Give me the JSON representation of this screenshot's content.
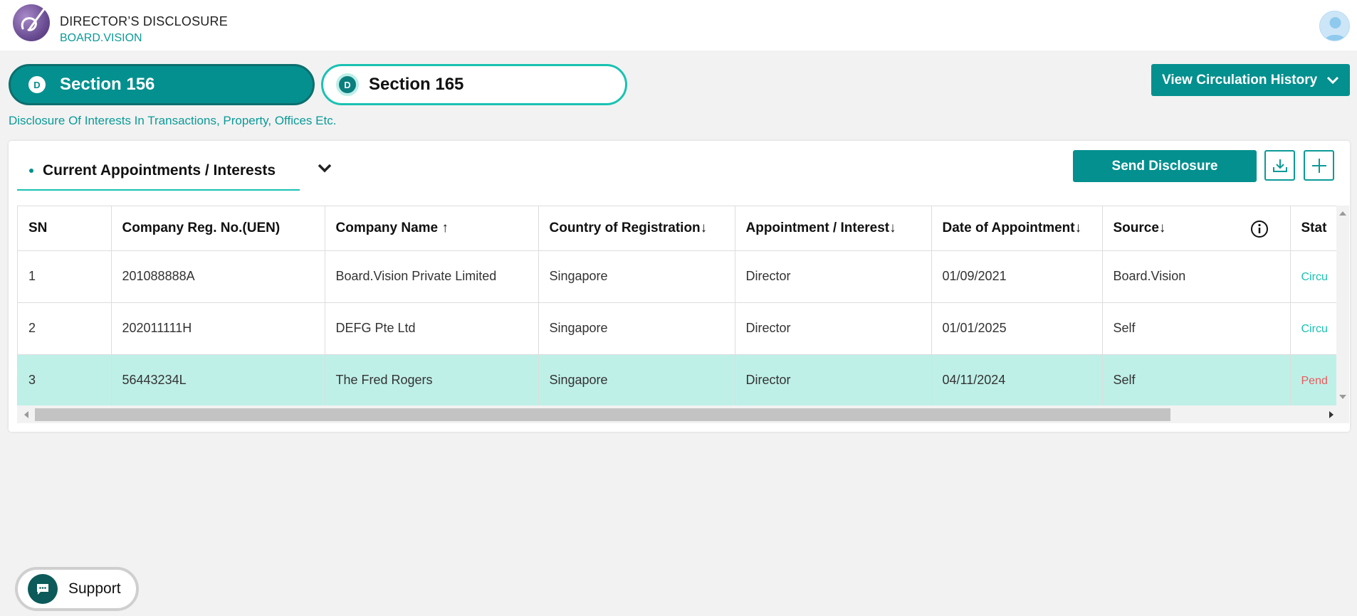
{
  "header": {
    "title": "DIRECTOR’S DISCLOSURE",
    "subtitle": "BOARD.VISION"
  },
  "section_tabs": [
    {
      "badge": "D",
      "label": "Section 156",
      "active": true
    },
    {
      "badge": "D",
      "label": "Section 165",
      "active": false
    }
  ],
  "history_button": "View Circulation History",
  "page_subtitle": "Disclosure Of Interests In Transactions, Property, Offices Etc.",
  "panel": {
    "tab_label": "Current Appointments / Interests",
    "send_button": "Send Disclosure"
  },
  "table": {
    "headers": [
      {
        "label": "SN",
        "sort": ""
      },
      {
        "label": "Company Reg. No.(UEN)",
        "sort": ""
      },
      {
        "label": "Company Name",
        "sort": "↑"
      },
      {
        "label": "Country of Registration",
        "sort": "↓"
      },
      {
        "label": "Appointment / Interest",
        "sort": "↓"
      },
      {
        "label": "Date of Appointment",
        "sort": "↓"
      },
      {
        "label": "Source",
        "sort": "↓"
      },
      {
        "label": "Stat",
        "sort": ""
      }
    ],
    "rows": [
      {
        "sn": "1",
        "uen": "201088888A",
        "company": "Board.Vision Private Limited",
        "country": "Singapore",
        "appointment": "Director",
        "date": "01/09/2021",
        "source": "Board.Vision",
        "status": "Circu"
      },
      {
        "sn": "2",
        "uen": "202011111H",
        "company": "DEFG Pte Ltd",
        "country": "Singapore",
        "appointment": "Director",
        "date": "01/01/2025",
        "source": "Self",
        "status": "Circu"
      },
      {
        "sn": "3",
        "uen": "56443234L",
        "company": "The Fred Rogers",
        "country": "Singapore",
        "appointment": "Director",
        "date": "04/11/2024",
        "source": "Self",
        "status": "Pend"
      }
    ]
  },
  "support_label": "Support",
  "colors": {
    "primary": "#04908f",
    "accent": "#19c2b2",
    "selected_row": "#bff0e8",
    "pending": "#e85a5a"
  },
  "icons": [
    "logo-icon",
    "avatar-icon",
    "chevron-down-icon",
    "download-icon",
    "plus-icon",
    "info-icon",
    "chat-icon"
  ]
}
